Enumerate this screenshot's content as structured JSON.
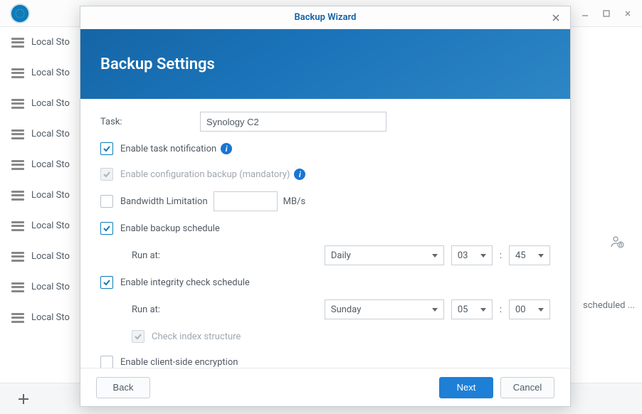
{
  "sidebar": {
    "items": [
      {
        "label": "Local Sto"
      },
      {
        "label": "Local Sto"
      },
      {
        "label": "Local Sto"
      },
      {
        "label": "Local Sto"
      },
      {
        "label": "Local Sto"
      },
      {
        "label": "Local Sto"
      },
      {
        "label": "Local Sto"
      },
      {
        "label": "Local Sto"
      },
      {
        "label": "Local Sto"
      },
      {
        "label": "Local Sto"
      }
    ]
  },
  "main": {
    "scheduled_text": "scheduled ..."
  },
  "modal": {
    "title": "Backup Wizard",
    "heading": "Backup Settings",
    "task_label": "Task:",
    "task_value": "Synology C2",
    "enable_notification_label": "Enable task notification",
    "enable_config_backup_label": "Enable configuration backup (mandatory)",
    "bandwidth_label": "Bandwidth Limitation",
    "bandwidth_unit": "MB/s",
    "enable_schedule_label": "Enable backup schedule",
    "run_at_label": "Run at:",
    "schedule_frequency": "Daily",
    "schedule_hour": "03",
    "schedule_minute": "45",
    "enable_integrity_label": "Enable integrity check schedule",
    "integrity_day": "Sunday",
    "integrity_hour": "05",
    "integrity_minute": "00",
    "check_index_label": "Check index structure",
    "enable_encryption_label": "Enable client-side encryption",
    "back_button": "Back",
    "next_button": "Next",
    "cancel_button": "Cancel"
  }
}
